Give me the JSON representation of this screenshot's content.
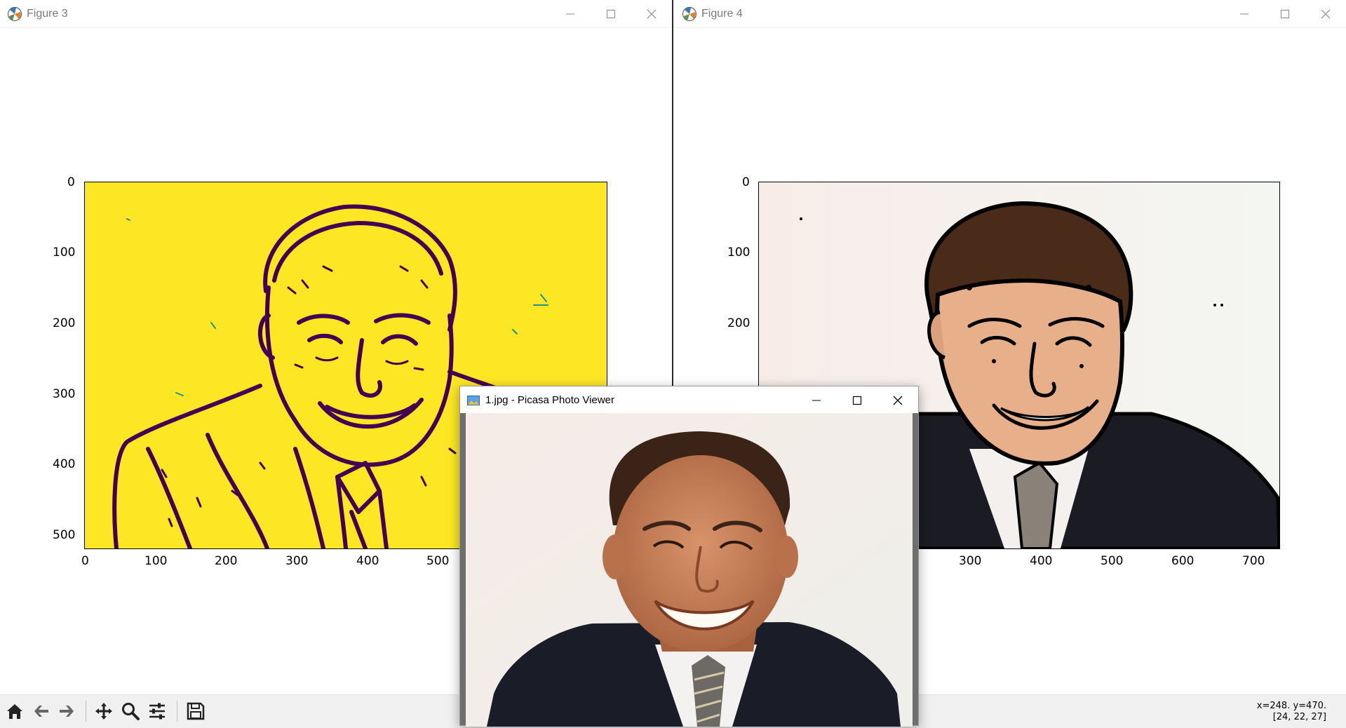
{
  "figure3": {
    "title": "Figure 3",
    "yticks": [
      "0",
      "100",
      "200",
      "300",
      "400",
      "500"
    ],
    "xticks": [
      "0",
      "100",
      "200",
      "300",
      "400",
      "500"
    ],
    "colormap": "viridis-like edge map",
    "colors": {
      "background": "#fde725",
      "edges": "#440154",
      "mid": "#21918c"
    }
  },
  "figure4": {
    "title": "Figure 4",
    "yticks": [
      "0",
      "100",
      "200"
    ],
    "xticks": [
      "300",
      "400",
      "500",
      "600",
      "700"
    ],
    "status_line1": "x=248. y=470.",
    "status_line2": "[24, 22, 27]"
  },
  "picasa": {
    "title": "1.jpg - Picasa Photo Viewer"
  },
  "toolbar": {
    "icons": [
      "home-icon",
      "back-icon",
      "forward-icon",
      "pan-icon",
      "zoom-icon",
      "configure-icon",
      "save-icon"
    ]
  }
}
